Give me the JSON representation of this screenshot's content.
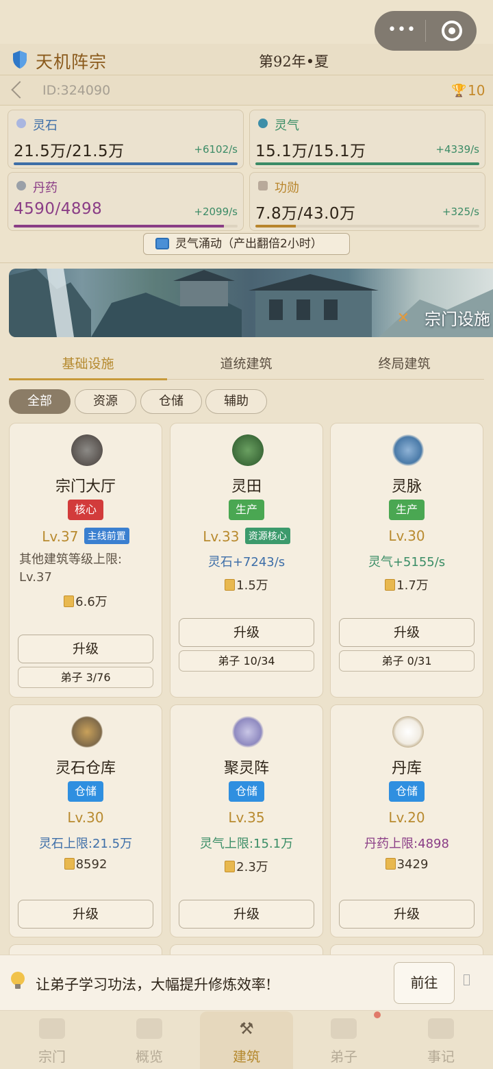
{
  "header": {
    "sect_name": "天机阵宗",
    "year_season": "第92年•夏",
    "user_id": "ID:324090",
    "trophy_count": "10",
    "capsule_menu": "•••"
  },
  "resources": [
    {
      "name": "灵石",
      "amount": "21.5万/21.5万",
      "rate": "+6102/s",
      "fill": 1.0,
      "color": "#3e6ea7",
      "text_color": "#2e2418"
    },
    {
      "name": "灵气",
      "amount": "15.1万/15.1万",
      "rate": "+4339/s",
      "fill": 1.0,
      "color": "#3b8b66",
      "text_color": "#2e2418"
    },
    {
      "name": "丹药",
      "amount": "4590/4898",
      "rate": "+2099/s",
      "fill": 0.94,
      "color": "#8a3d86",
      "text_color": "#8a3d86"
    },
    {
      "name": "功勋",
      "amount": "7.8万/43.0万",
      "rate": "+325/s",
      "fill": 0.18,
      "color": "#b8852c",
      "text_color": "#2e2418"
    }
  ],
  "boost_button": "灵气涌动（产出翻倍2小时）",
  "banner_title": "宗门设施",
  "tabs": [
    "基础设施",
    "道统建筑",
    "终局建筑"
  ],
  "filters": [
    "全部",
    "资源",
    "仓储",
    "辅助"
  ],
  "buildings": [
    {
      "name": "宗门大厅",
      "tag": "核心",
      "tag_color": "#d23b3b",
      "level": "Lv.37",
      "pill": "主线前置",
      "pill_color": "#3a7fd0",
      "effect": "",
      "note": "其他建筑等级上限:",
      "note2": "Lv.37",
      "cost": "6.6万",
      "upgrade": "升级",
      "disciples": "弟子 3/76"
    },
    {
      "name": "灵田",
      "tag": "生产",
      "tag_color": "#4aa752",
      "level": "Lv.33",
      "pill": "资源核心",
      "pill_color": "#3c9a6c",
      "effect": "灵石+7243/s",
      "effect_color": "#3d6ea8",
      "cost": "1.5万",
      "upgrade": "升级",
      "disciples": "弟子 10/34"
    },
    {
      "name": "灵脉",
      "tag": "生产",
      "tag_color": "#4aa752",
      "level": "Lv.30",
      "effect": "灵气+5155/s",
      "effect_color": "#3a8d66",
      "cost": "1.7万",
      "upgrade": "升级",
      "disciples": "弟子 0/31"
    },
    {
      "name": "灵石仓库",
      "tag": "仓储",
      "tag_color": "#2f8fe0",
      "level": "Lv.30",
      "effect": "灵石上限:21.5万",
      "effect_color": "#3d6ea8",
      "cost": "8592",
      "upgrade": "升级"
    },
    {
      "name": "聚灵阵",
      "tag": "仓储",
      "tag_color": "#2f8fe0",
      "level": "Lv.35",
      "effect": "灵气上限:15.1万",
      "effect_color": "#3a8d66",
      "cost": "2.3万",
      "upgrade": "升级"
    },
    {
      "name": "丹库",
      "tag": "仓储",
      "tag_color": "#2f8fe0",
      "level": "Lv.20",
      "effect": "丹药上限:4898",
      "effect_color": "#8a3d86",
      "cost": "3429",
      "upgrade": "升级"
    }
  ],
  "tip": {
    "text": "让弟子学习功法，大幅提升修炼效率!",
    "button": "前往"
  },
  "nav": [
    {
      "label": "宗门",
      "icon": "sect-hall-icon"
    },
    {
      "label": "概览",
      "icon": "overview-scroll-icon"
    },
    {
      "label": "建筑",
      "icon": "hammer-tools-icon"
    },
    {
      "label": "弟子",
      "icon": "disciple-icon"
    },
    {
      "label": "事记",
      "icon": "records-icon"
    }
  ]
}
